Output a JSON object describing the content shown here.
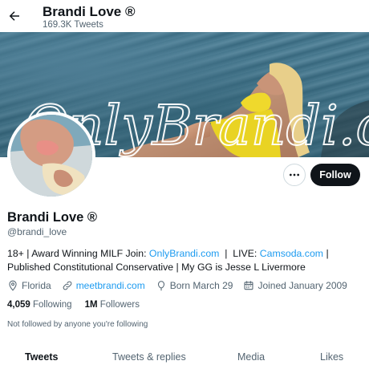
{
  "header": {
    "title": "Brandi Love ®",
    "tweet_count": "169.3K Tweets",
    "back_icon": "arrow-left-icon"
  },
  "banner": {
    "overlay_text": "OnlyBrandi.com"
  },
  "actions": {
    "more_icon": "more-horizontal-icon",
    "follow_label": "Follow"
  },
  "profile": {
    "name": "Brandi Love ®",
    "handle": "@brandi_love",
    "bio": {
      "part1": "18+ | Award Winning MILF Join: ",
      "link1": "OnlyBrandi.com",
      "part2": "  |  LIVE: ",
      "link2": "Camsoda.com",
      "part3": " | Published Constitutional Conservative | My GG is Jesse L Livermore"
    },
    "location": "Florida",
    "website": "meetbrandi.com",
    "birthday": "Born March 29",
    "joined": "Joined January 2009"
  },
  "stats": {
    "following_count": "4,059",
    "following_label": "Following",
    "followers_count": "1M",
    "followers_label": "Followers"
  },
  "social_context": "Not followed by anyone you're following",
  "tabs": [
    "Tweets",
    "Tweets & replies",
    "Media",
    "Likes"
  ],
  "colors": {
    "accent": "#1d9bf0",
    "text": "#0f1419",
    "muted": "#536471",
    "follow_button": "#0f1419"
  }
}
